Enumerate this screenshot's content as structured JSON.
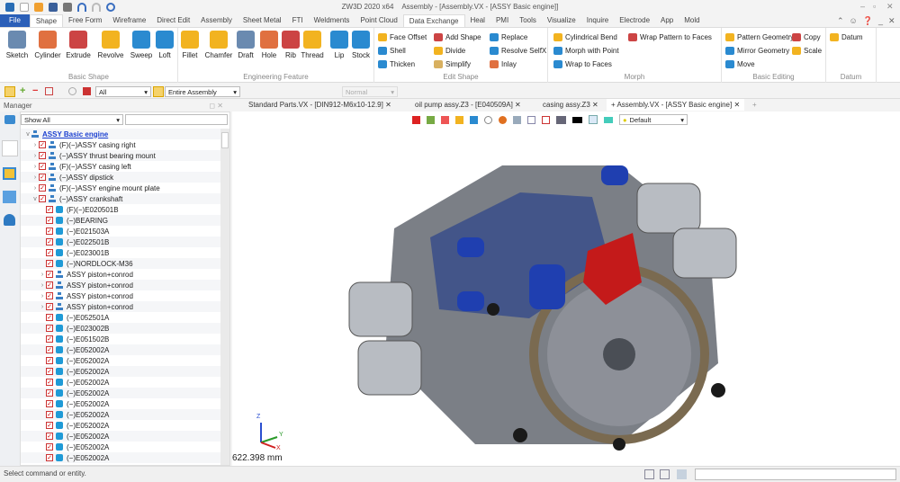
{
  "app": {
    "title": "ZW3D 2020 x64",
    "document_title": "Assembly - [Assembly.VX - [ASSY Basic engine]]"
  },
  "menu": [
    "File",
    "Shape",
    "Free Form",
    "Wireframe",
    "Direct Edit",
    "Assembly",
    "Sheet Metal",
    "FTI",
    "Weldments",
    "Point Cloud",
    "Data Exchange",
    "Heal",
    "PMI",
    "Tools",
    "Visualize",
    "Inquire",
    "Electrode",
    "App",
    "Mold"
  ],
  "ribbon": {
    "basic_shape": {
      "label": "Basic Shape",
      "items": [
        "Sketch",
        "Cylinder",
        "Extrude",
        "Revolve",
        "Sweep",
        "Loft"
      ]
    },
    "engineering_feature": {
      "label": "Engineering Feature",
      "items": [
        "Fillet",
        "Chamfer",
        "Draft",
        "Hole",
        "Rib",
        "Thread",
        "Lip",
        "Stock"
      ]
    },
    "edit_shape": {
      "label": "Edit Shape",
      "items": [
        "Face Offset",
        "Shell",
        "Thicken",
        "Add Shape",
        "Divide",
        "Simplify",
        "Replace",
        "Resolve SelfX",
        "Inlay"
      ]
    },
    "morph": {
      "label": "Morph",
      "items": [
        "Cylindrical Bend",
        "Morph with Point",
        "Wrap to Faces",
        "Wrap Pattern to Faces"
      ]
    },
    "basic_editing": {
      "label": "Basic Editing",
      "items": [
        "Pattern Geometry",
        "Mirror Geometry",
        "Move",
        "Copy",
        "Scale"
      ]
    },
    "datum": {
      "label": "Datum",
      "items": [
        "Datum"
      ]
    }
  },
  "toolbar": {
    "filter": "All",
    "scope": "Entire Assembly",
    "render_mode": "Normal"
  },
  "manager": {
    "title": "Manager",
    "filter": "Show All",
    "search": ""
  },
  "tree": [
    {
      "label": "ASSY Basic engine",
      "type": "root",
      "depth": 0
    },
    {
      "label": "(F)(−)ASSY casing right",
      "type": "asm",
      "depth": 1
    },
    {
      "label": "(−)ASSY thrust bearing mount",
      "type": "asm",
      "depth": 1
    },
    {
      "label": "(F)(−)ASSY casing left",
      "type": "asm",
      "depth": 1
    },
    {
      "label": "(−)ASSY dipstick",
      "type": "asm",
      "depth": 1
    },
    {
      "label": "(F)(−)ASSY engine mount plate",
      "type": "asm",
      "depth": 1
    },
    {
      "label": "(−)ASSY crankshaft",
      "type": "asm",
      "depth": 1,
      "open": true
    },
    {
      "label": "(F)(−)E020501B",
      "type": "part",
      "depth": 2
    },
    {
      "label": "(−)BEARING",
      "type": "part",
      "depth": 2
    },
    {
      "label": "(−)E021503A",
      "type": "part",
      "depth": 2
    },
    {
      "label": "(−)E022501B",
      "type": "part",
      "depth": 2
    },
    {
      "label": "(−)E023001B",
      "type": "part",
      "depth": 2
    },
    {
      "label": "(−)NORDLOCK-M36",
      "type": "part",
      "depth": 2
    },
    {
      "label": "ASSY piston+conrod",
      "type": "asm",
      "depth": 2
    },
    {
      "label": "ASSY piston+conrod",
      "type": "asm",
      "depth": 2
    },
    {
      "label": "ASSY piston+conrod",
      "type": "asm",
      "depth": 2
    },
    {
      "label": "ASSY piston+conrod",
      "type": "asm",
      "depth": 2
    },
    {
      "label": "(−)E052501A",
      "type": "part",
      "depth": 2
    },
    {
      "label": "(−)E023002B",
      "type": "part",
      "depth": 2
    },
    {
      "label": "(−)E051502B",
      "type": "part",
      "depth": 2
    },
    {
      "label": "(−)E052002A",
      "type": "part",
      "depth": 2
    },
    {
      "label": "(−)E052002A",
      "type": "part",
      "depth": 2
    },
    {
      "label": "(−)E052002A",
      "type": "part",
      "depth": 2
    },
    {
      "label": "(−)E052002A",
      "type": "part",
      "depth": 2
    },
    {
      "label": "(−)E052002A",
      "type": "part",
      "depth": 2
    },
    {
      "label": "(−)E052002A",
      "type": "part",
      "depth": 2
    },
    {
      "label": "(−)E052002A",
      "type": "part",
      "depth": 2
    },
    {
      "label": "(−)E052002A",
      "type": "part",
      "depth": 2
    },
    {
      "label": "(−)E052002A",
      "type": "part",
      "depth": 2
    },
    {
      "label": "(−)E052002A",
      "type": "part",
      "depth": 2
    },
    {
      "label": "(−)E052002A",
      "type": "part",
      "depth": 2
    }
  ],
  "doc_tabs": [
    "Standard Parts.VX - [DIN912-M6x10-12.9]",
    "oil pump assy.Z3 - [E040509A]",
    "casing assy.Z3",
    "Assembly.VX - [ASSY Basic engine]"
  ],
  "view": {
    "style": "Default",
    "scale": "622.398 mm",
    "axes": [
      "X",
      "Y",
      "Z"
    ]
  },
  "status": {
    "message": "Select command or entity."
  }
}
